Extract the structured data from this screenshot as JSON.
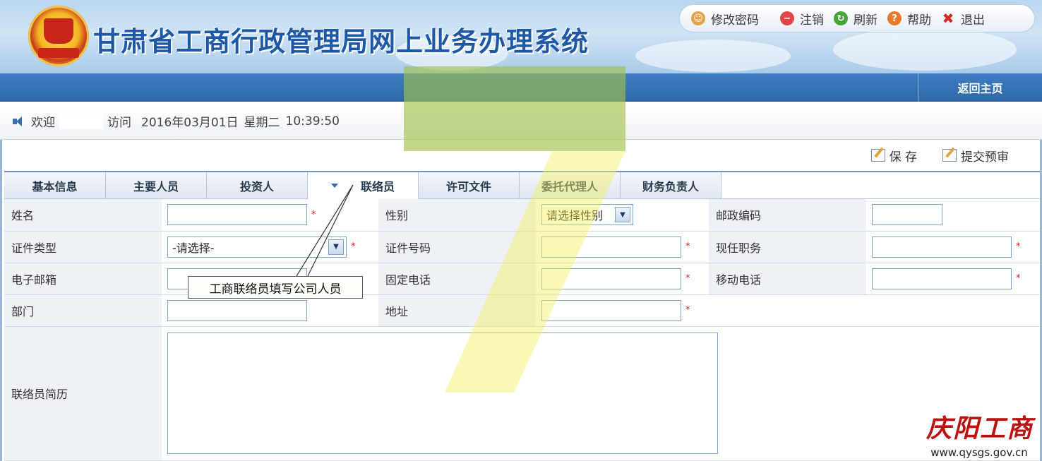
{
  "header": {
    "system_title": "甘肃省工商行政管理局网上业务办理系统",
    "top_menu": [
      {
        "label": "修改密码",
        "icon": "user-key-icon"
      },
      {
        "label": "注销",
        "icon": "logout-icon"
      },
      {
        "label": "刷新",
        "icon": "refresh-icon"
      },
      {
        "label": "帮助",
        "icon": "help-icon"
      },
      {
        "label": "退出",
        "icon": "close-icon"
      }
    ],
    "home_link": "返回主页"
  },
  "welcome": {
    "greeting": "欢迎",
    "visit": "访问",
    "date": "2016年03月01日",
    "weekday": "星期二",
    "time": "10:39:50"
  },
  "actions": {
    "save": "保 存",
    "submit": "提交预审"
  },
  "tabs": [
    {
      "label": "基本信息"
    },
    {
      "label": "主要人员"
    },
    {
      "label": "投资人"
    },
    {
      "label": "联络员",
      "active": true
    },
    {
      "label": "许可文件"
    },
    {
      "label": "委托代理人"
    },
    {
      "label": "财务负责人"
    }
  ],
  "form": {
    "name_label": "姓名",
    "gender_label": "性别",
    "gender_value": "请选择性别",
    "postcode_label": "邮政编码",
    "id_type_label": "证件类型",
    "id_type_value": "-请选择-",
    "id_number_label": "证件号码",
    "position_label": "现任职务",
    "email_label": "电子邮箱",
    "phone_label": "固定电话",
    "mobile_label": "移动电话",
    "dept_label": "部门",
    "address_label": "地址",
    "resume_label": "联络员简历",
    "required_mark": "*"
  },
  "annotation": {
    "callout": "工商联络员填写公司人员",
    "watermark_digit": "7"
  },
  "watermark": {
    "brand": "庆阳工商",
    "url": "www.qysgs.gov.cn"
  },
  "colors": {
    "title_blue": "#1e59a8",
    "navbar_blue": "#2f69a9",
    "required_red": "#dd2222",
    "watermark_yellow": "#f2f060"
  }
}
